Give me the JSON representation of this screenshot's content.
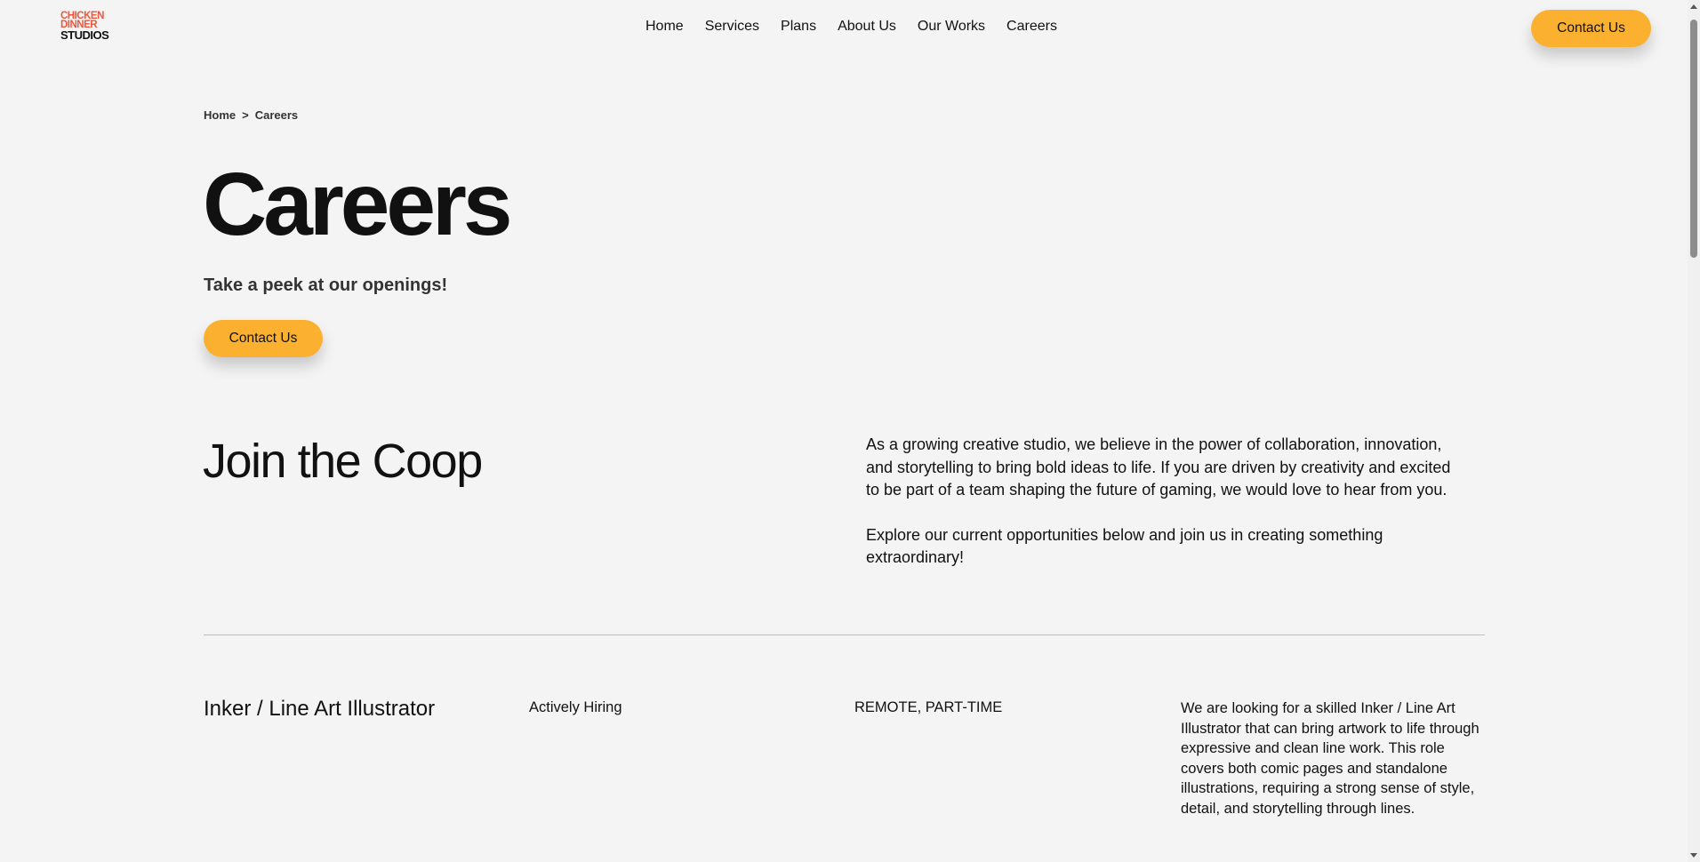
{
  "header": {
    "logo": {
      "line1": "CHICKEN",
      "line2": "DINNER",
      "line3": "STUDIOS"
    },
    "nav": [
      "Home",
      "Services",
      "Plans",
      "About Us",
      "Our Works",
      "Careers"
    ],
    "contact_label": "Contact Us"
  },
  "breadcrumb": {
    "home": "Home",
    "separator": ">",
    "current": "Careers"
  },
  "hero": {
    "title": "Careers",
    "subtitle": "Take a peek at our openings!",
    "contact_label": "Contact Us"
  },
  "join": {
    "title": "Join the Coop",
    "paragraph1": "As a growing creative studio, we believe in the power of collaboration, innovation, and storytelling to bring bold ideas to life. If you are driven by creativity and excited to be part of a team shaping the future of gaming, we would love to hear from you.",
    "paragraph2": "Explore our current opportunities below and join us in creating something extraordinary!"
  },
  "jobs": [
    {
      "title": "Inker / Line Art Illustrator",
      "status": "Actively Hiring",
      "type": "REMOTE, PART-TIME",
      "description": "We are looking for a skilled Inker / Line Art Illustrator that can bring artwork to life through expressive and clean line work. This role covers both comic pages and standalone illustrations, requiring a strong sense of style, detail, and storytelling through lines."
    }
  ],
  "colors": {
    "accent": "#fbb12f",
    "logo_red": "#f0553b",
    "background": "#f4f4f4"
  }
}
